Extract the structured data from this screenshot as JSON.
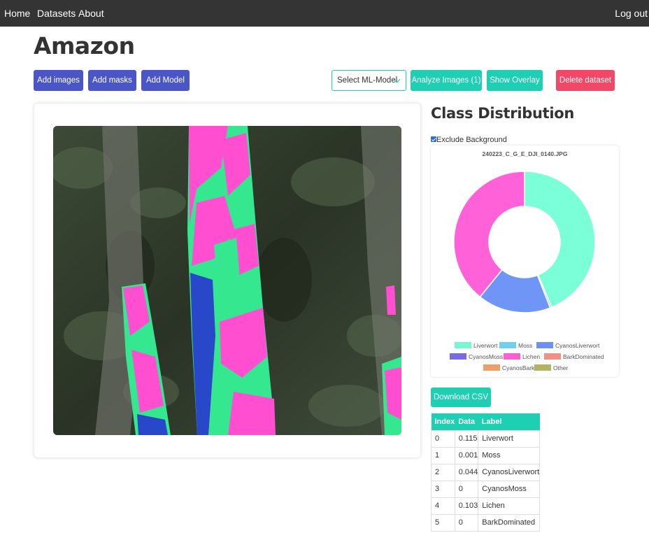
{
  "nav": {
    "home": "Home",
    "datasets": "Datasets",
    "about": "About",
    "logout": "Log out"
  },
  "page": {
    "title": "Amazon"
  },
  "toolbar": {
    "add_images": "Add images",
    "add_masks": "Add masks",
    "add_model": "Add Model",
    "select_model": "Select ML-Model",
    "analyze": "Analyze Images (1)",
    "show_overlay": "Show Overlay",
    "delete_dataset": "Delete dataset"
  },
  "colors": {
    "nav_bg": "#343434",
    "indigo": "#4a56c5",
    "teal": "#1ecfb3",
    "red": "#f24867"
  },
  "sidebar": {
    "title": "Class Distribution",
    "exclude_label": "Exclude Background",
    "exclude_checked": true,
    "download_csv": "Download CSV"
  },
  "chart_data": {
    "type": "pie",
    "title": "240223_C_G_E_DJI_0140.JPG",
    "legend_position": "bottom",
    "labels": [
      "Liverwort",
      "Moss",
      "CyanosLiverwort",
      "CyanosMoss",
      "Lichen",
      "BarkDominated",
      "CyanosBark",
      "Other"
    ],
    "values": [
      0.115,
      0.001,
      0.044,
      0,
      0.103,
      0,
      0,
      0
    ],
    "colors": [
      "#7affd9",
      "#75d4f5",
      "#6f95f7",
      "#7b6ee6",
      "#ff62d8",
      "#f7958a",
      "#f5a46a",
      "#b9b86a"
    ],
    "donut": true
  },
  "table": {
    "headers": [
      "Index",
      "Data",
      "Label"
    ],
    "rows": [
      [
        "0",
        "0.115",
        "Liverwort"
      ],
      [
        "1",
        "0.001",
        "Moss"
      ],
      [
        "2",
        "0.044",
        "CyanosLiverwort"
      ],
      [
        "3",
        "0",
        "CyanosMoss"
      ],
      [
        "4",
        "0.103",
        "Lichen"
      ],
      [
        "5",
        "0",
        "BarkDominated"
      ]
    ]
  }
}
